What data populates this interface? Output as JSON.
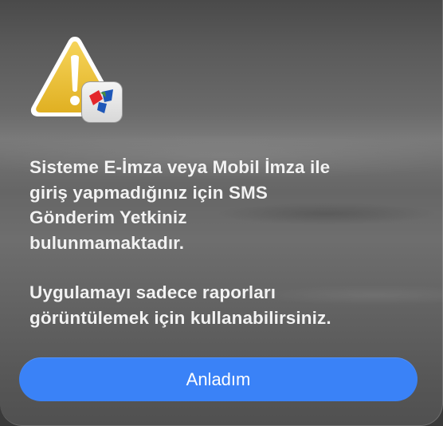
{
  "dialog": {
    "icon": "warning-icon",
    "badge_icon": "app-badge-icon",
    "message_paragraphs": [
      "Sisteme E-İmza veya Mobil İmza ile\ngiriş yapmadığınız için SMS\nGönderim Yetkiniz\nbulunmamaktadır.",
      "Uygulamayı sadece raporları\ngörüntülemek için kullanabilirsiniz."
    ],
    "button_label": "Anladım"
  },
  "colors": {
    "button": "#3a82f7",
    "warning": "#f0c43a",
    "badge_red": "#e3262b",
    "badge_blue": "#1e57b8"
  }
}
